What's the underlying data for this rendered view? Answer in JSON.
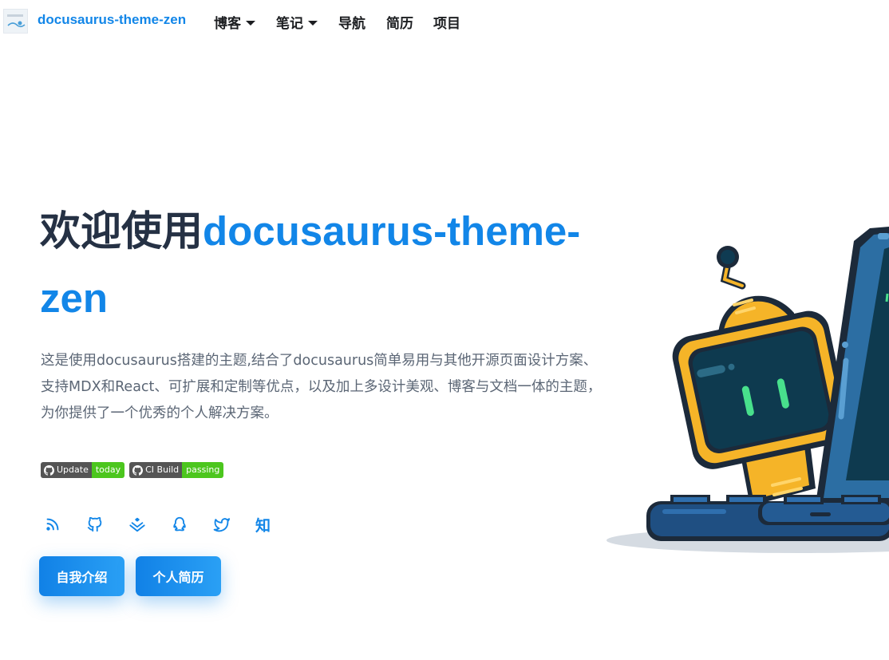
{
  "navbar": {
    "brand": "docusaurus-theme-zen",
    "items": [
      {
        "label": "博客",
        "dropdown": true
      },
      {
        "label": "笔记",
        "dropdown": true
      },
      {
        "label": "导航",
        "dropdown": false
      },
      {
        "label": "简历",
        "dropdown": false
      },
      {
        "label": "项目",
        "dropdown": false
      }
    ]
  },
  "hero": {
    "title_prefix": "欢迎使用",
    "title_accent_line1": "docusaurus-theme-",
    "title_accent_line2": "zen",
    "description": "这是使用docusaurus搭建的主题,结合了docusaurus简单易用与其他开源页面设计方案、支持MDX和React、可扩展和定制等优点，以及加上多设计美观、博客与文档一体的主题，为你提供了一个优秀的个人解决方案。",
    "badges": [
      {
        "label": "Update",
        "value": "today",
        "icon": "github-icon"
      },
      {
        "label": "CI Build",
        "value": "passing",
        "icon": "github-icon"
      }
    ],
    "social": [
      {
        "icon": "rss-icon"
      },
      {
        "icon": "github-icon"
      },
      {
        "icon": "juejin-icon"
      },
      {
        "icon": "qq-icon"
      },
      {
        "icon": "twitter-icon"
      },
      {
        "icon": "zhihu-icon",
        "text": "知"
      }
    ],
    "buttons": {
      "intro": "自我介绍",
      "resume": "个人简历"
    }
  },
  "colors": {
    "accent": "#1286e8",
    "title": "#253144",
    "text": "#5b6675",
    "badge_dark": "#555555",
    "badge_green": "#4cc61e"
  }
}
